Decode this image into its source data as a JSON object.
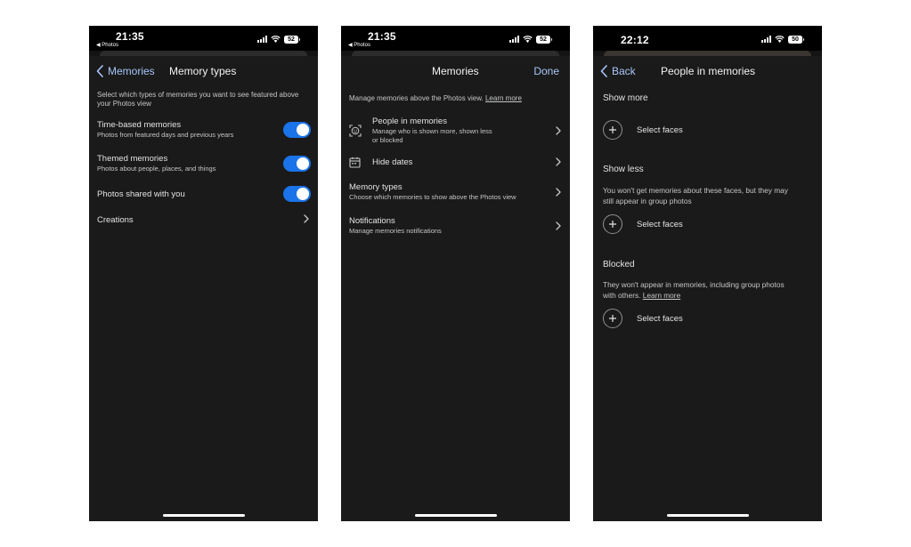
{
  "screens": [
    {
      "status": {
        "time": "21:35",
        "back_app": "◀ Photos",
        "battery": "52"
      },
      "nav": {
        "back_label": "Memories",
        "title": "Memory types"
      },
      "description": "Select which types of memories you want to see featured above your Photos view",
      "rows": [
        {
          "title": "Time-based memories",
          "subtitle": "Photos from featured days and previous years",
          "toggle_on": true
        },
        {
          "title": "Themed memories",
          "subtitle": "Photos about people, places, and things",
          "toggle_on": true
        },
        {
          "title": "Photos shared with you",
          "toggle_on": true
        },
        {
          "title": "Creations"
        }
      ]
    },
    {
      "status": {
        "time": "21:35",
        "back_app": "◀ Photos",
        "battery": "52"
      },
      "nav": {
        "title": "Memories",
        "done_label": "Done"
      },
      "description": "Manage memories above the Photos view.",
      "learn_more": "Learn more",
      "rows": [
        {
          "icon": "face-icon",
          "title": "People in memories",
          "subtitle_line1": "Manage who is shown more, shown less",
          "subtitle_line2": "or blocked"
        },
        {
          "icon": "calendar-icon",
          "title": "Hide dates"
        },
        {
          "title": "Memory types",
          "subtitle": "Choose which memories to show above the Photos view"
        },
        {
          "title": "Notifications",
          "subtitle": "Manage memories notifications"
        }
      ]
    },
    {
      "status": {
        "time": "22:12",
        "battery": "50"
      },
      "nav": {
        "back_label": "Back",
        "title": "People in memories"
      },
      "sections": [
        {
          "title": "Show more",
          "action": "Select faces"
        },
        {
          "title": "Show less",
          "desc_line1": "You won't get memories about these faces, but they may",
          "desc_line2": "still appear in group photos",
          "action": "Select faces"
        },
        {
          "title": "Blocked",
          "desc_line1": "They won't appear in memories, including group photos",
          "desc_line2_prefix": "with others.",
          "learn_more": "Learn more",
          "action": "Select faces"
        }
      ]
    }
  ]
}
